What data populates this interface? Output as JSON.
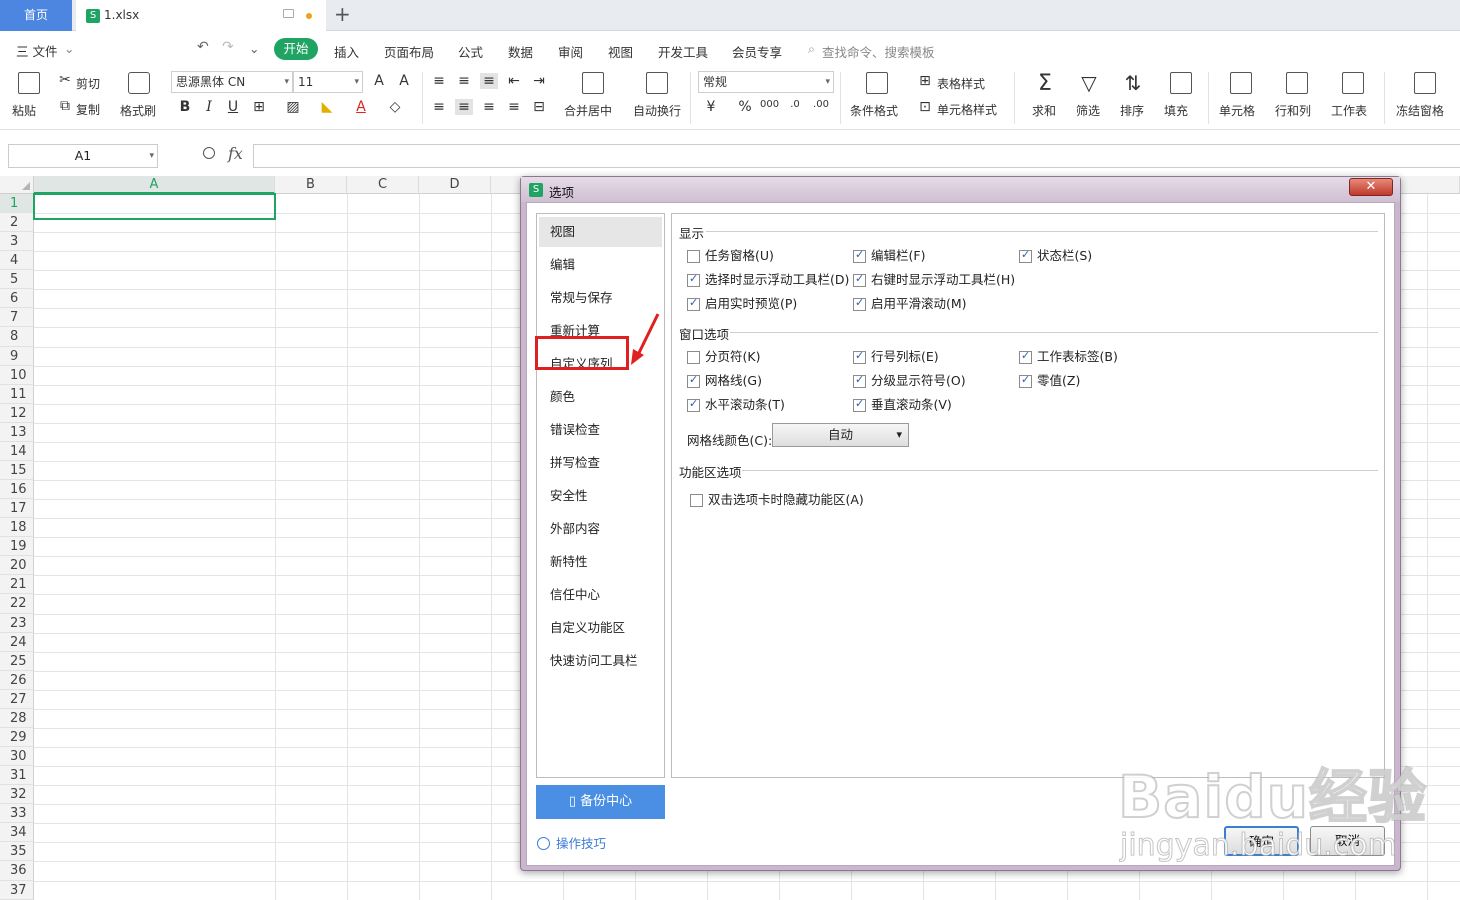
{
  "tabs": {
    "home": "首页",
    "file": "1.xlsx"
  },
  "menubar": {
    "file": "三 文件",
    "start": "开始",
    "items": [
      "插入",
      "页面布局",
      "公式",
      "数据",
      "审阅",
      "视图",
      "开发工具",
      "会员专享"
    ],
    "search_placeholder": "查找命令、搜索模板"
  },
  "ribbon": {
    "paste": "粘贴",
    "cut": "剪切",
    "copy": "复制",
    "format_painter": "格式刷",
    "font_name": "思源黑体 CN",
    "font_size": "11",
    "number_format": "常规",
    "merge_center": "合并居中",
    "wrap_text": "自动换行",
    "cond_format": "条件格式",
    "table_style": "表格样式",
    "cell_style": "单元格样式",
    "sum": "求和",
    "filter": "筛选",
    "sort": "排序",
    "fill": "填充",
    "cells": "单元格",
    "rows_cols": "行和列",
    "worksheet": "工作表",
    "freeze": "冻结窗格"
  },
  "formula_bar": {
    "name_box": "A1",
    "fx": "fx"
  },
  "sheet": {
    "columns": [
      "A",
      "B",
      "C",
      "D"
    ],
    "rows": [
      "1",
      "2",
      "3",
      "4",
      "5",
      "6",
      "7",
      "8",
      "9",
      "10",
      "11",
      "12",
      "13",
      "14",
      "15",
      "16",
      "17",
      "18",
      "19",
      "20",
      "21",
      "22",
      "23",
      "24",
      "25",
      "26",
      "27",
      "28",
      "29",
      "30",
      "31",
      "32",
      "33",
      "34",
      "35",
      "36",
      "37"
    ]
  },
  "dialog": {
    "title": "选项",
    "nav": [
      "视图",
      "编辑",
      "常规与保存",
      "重新计算",
      "自定义序列",
      "颜色",
      "错误检查",
      "拼写检查",
      "安全性",
      "外部内容",
      "新特性",
      "信任中心",
      "自定义功能区",
      "快速访问工具栏"
    ],
    "backup": "备份中心",
    "tips": "操作技巧",
    "sections": {
      "display": "显示",
      "window": "窗口选项",
      "ribbon": "功能区选项"
    },
    "display_options": [
      {
        "label": "任务窗格(U)",
        "checked": false
      },
      {
        "label": "编辑栏(F)",
        "checked": true
      },
      {
        "label": "状态栏(S)",
        "checked": true
      },
      {
        "label": "选择时显示浮动工具栏(D)",
        "checked": true
      },
      {
        "label": "右键时显示浮动工具栏(H)",
        "checked": true
      },
      {
        "label": "启用实时预览(P)",
        "checked": true
      },
      {
        "label": "启用平滑滚动(M)",
        "checked": true
      }
    ],
    "window_options": [
      {
        "label": "分页符(K)",
        "checked": false
      },
      {
        "label": "行号列标(E)",
        "checked": true
      },
      {
        "label": "工作表标签(B)",
        "checked": true
      },
      {
        "label": "网格线(G)",
        "checked": true
      },
      {
        "label": "分级显示符号(O)",
        "checked": true
      },
      {
        "label": "零值(Z)",
        "checked": true
      },
      {
        "label": "水平滚动条(T)",
        "checked": true
      },
      {
        "label": "垂直滚动条(V)",
        "checked": true
      }
    ],
    "grid_color_label": "网格线颜色(C):",
    "grid_color_value": "自动",
    "ribbon_options": [
      {
        "label": "双击选项卡时隐藏功能区(A)",
        "checked": false
      }
    ],
    "ok": "确定",
    "cancel": "取消"
  },
  "watermark": {
    "brand": "Baidu经验",
    "url": "jingyan.baidu.com"
  },
  "colors": {
    "accent_green": "#1fa463",
    "highlight_red": "#e02020",
    "backup_blue": "#4a8fe4"
  }
}
